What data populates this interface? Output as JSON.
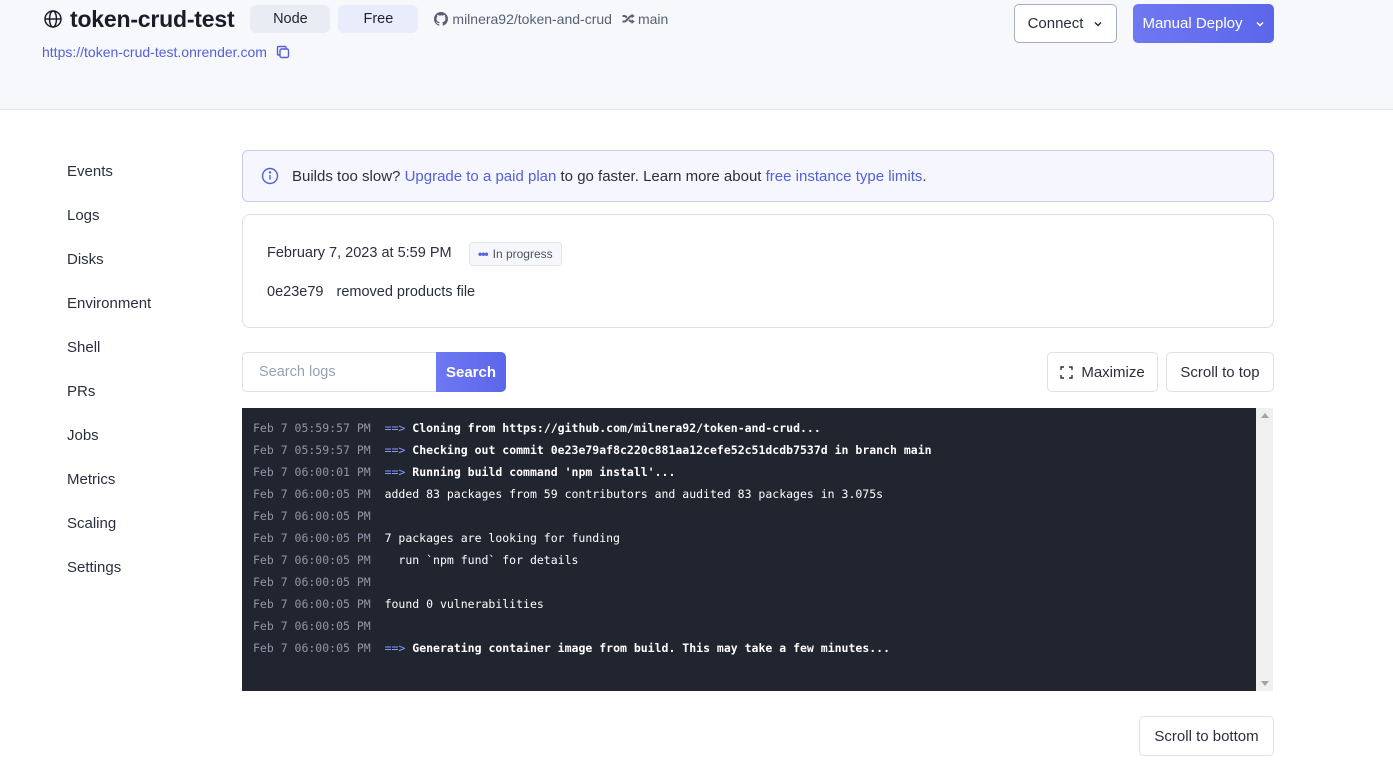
{
  "header": {
    "service_name": "token-crud-test",
    "runtime_pill": "Node",
    "plan_pill": "Free",
    "repo": "milnera92/token-and-crud",
    "branch": "main",
    "url": "https://token-crud-test.onrender.com",
    "connect_label": "Connect",
    "deploy_label": "Manual Deploy",
    "accent_color": "#5b66ea"
  },
  "sidebar": {
    "items": [
      {
        "label": "Events"
      },
      {
        "label": "Logs"
      },
      {
        "label": "Disks"
      },
      {
        "label": "Environment"
      },
      {
        "label": "Shell"
      },
      {
        "label": "PRs"
      },
      {
        "label": "Jobs"
      },
      {
        "label": "Metrics"
      },
      {
        "label": "Scaling"
      },
      {
        "label": "Settings"
      }
    ]
  },
  "banner": {
    "text_1": "Builds too slow? ",
    "link_1": "Upgrade to a paid plan",
    "text_2": " to go faster. Learn more about ",
    "link_2": "free instance type limits",
    "text_3": "."
  },
  "deploy": {
    "date": "February 7, 2023 at 5:59 PM",
    "status": "In progress",
    "commit_hash": "0e23e79",
    "commit_message": "removed products file"
  },
  "log_controls": {
    "search_placeholder": "Search logs",
    "search_button": "Search",
    "maximize_button": "Maximize",
    "scroll_top_button": "Scroll to top",
    "scroll_bottom_button": "Scroll to bottom"
  },
  "logs": [
    {
      "ts": "Feb 7 05:59:57 PM",
      "arrow": "==>",
      "msg": "Cloning from https://github.com/milnera92/token-and-crud...",
      "bold": true
    },
    {
      "ts": "Feb 7 05:59:57 PM",
      "arrow": "==>",
      "msg": "Checking out commit 0e23e79af8c220c881aa12cefe52c51dcdb7537d in branch main",
      "bold": true
    },
    {
      "ts": "Feb 7 06:00:01 PM",
      "arrow": "==>",
      "msg": "Running build command 'npm install'...",
      "bold": true
    },
    {
      "ts": "Feb 7 06:00:05 PM",
      "arrow": "",
      "msg": "added 83 packages from 59 contributors and audited 83 packages in 3.075s",
      "bold": false
    },
    {
      "ts": "Feb 7 06:00:05 PM",
      "arrow": "",
      "msg": "",
      "bold": false
    },
    {
      "ts": "Feb 7 06:00:05 PM",
      "arrow": "",
      "msg": "7 packages are looking for funding",
      "bold": false
    },
    {
      "ts": "Feb 7 06:00:05 PM",
      "arrow": "",
      "msg": "  run `npm fund` for details",
      "bold": false
    },
    {
      "ts": "Feb 7 06:00:05 PM",
      "arrow": "",
      "msg": "",
      "bold": false
    },
    {
      "ts": "Feb 7 06:00:05 PM",
      "arrow": "",
      "msg": "found 0 vulnerabilities",
      "bold": false
    },
    {
      "ts": "Feb 7 06:00:05 PM",
      "arrow": "",
      "msg": "",
      "bold": false
    },
    {
      "ts": "Feb 7 06:00:05 PM",
      "arrow": "==>",
      "msg": "Generating container image from build. This may take a few minutes...",
      "bold": true
    }
  ]
}
